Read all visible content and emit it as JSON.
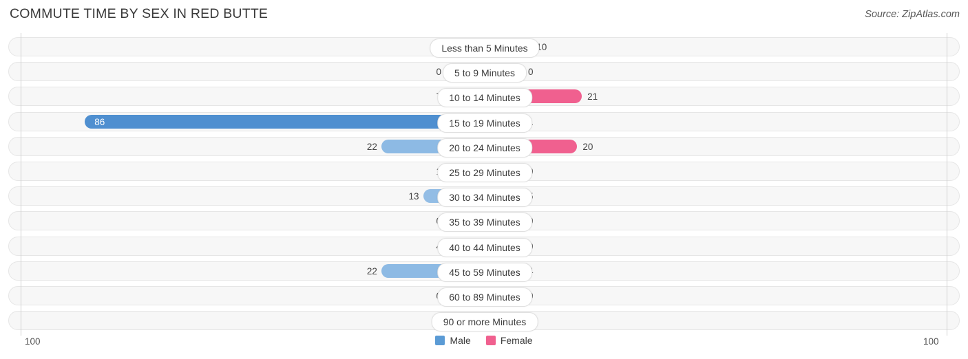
{
  "header": {
    "title": "COMMUTE TIME BY SEX IN RED BUTTE",
    "source": "Source: ZipAtlas.com"
  },
  "legend": {
    "items": [
      {
        "label": "Male",
        "color": "#5b9bd5"
      },
      {
        "label": "Female",
        "color": "#f0608f"
      }
    ]
  },
  "axis": {
    "left_tick": "100",
    "right_tick": "100",
    "max": 100
  },
  "chart_data": {
    "type": "bar",
    "subtype": "diverging-bidirectional",
    "title": "COMMUTE TIME BY SEX IN RED BUTTE",
    "xlabel": "",
    "ylabel": "",
    "xlim": [
      100,
      100
    ],
    "grid": false,
    "legend_position": "bottom-center",
    "categories": [
      "Less than 5 Minutes",
      "5 to 9 Minutes",
      "10 to 14 Minutes",
      "15 to 19 Minutes",
      "20 to 24 Minutes",
      "25 to 29 Minutes",
      "30 to 34 Minutes",
      "35 to 39 Minutes",
      "40 to 44 Minutes",
      "45 to 59 Minutes",
      "60 to 89 Minutes",
      "90 or more Minutes"
    ],
    "series": [
      {
        "name": "Male",
        "direction": "left",
        "color": "#5b9bd5",
        "values": [
          0,
          0,
          7,
          86,
          22,
          1,
          13,
          0,
          4,
          22,
          0,
          0
        ]
      },
      {
        "name": "Female",
        "direction": "right",
        "color": "#f0608f",
        "values": [
          10,
          0,
          21,
          1,
          20,
          0,
          5,
          0,
          0,
          4,
          0,
          0
        ]
      }
    ]
  },
  "rows": [
    {
      "label": "Less than 5 Minutes",
      "male": "0",
      "female": "10"
    },
    {
      "label": "5 to 9 Minutes",
      "male": "0",
      "female": "0"
    },
    {
      "label": "10 to 14 Minutes",
      "male": "7",
      "female": "21"
    },
    {
      "label": "15 to 19 Minutes",
      "male": "86",
      "female": "1"
    },
    {
      "label": "20 to 24 Minutes",
      "male": "22",
      "female": "20"
    },
    {
      "label": "25 to 29 Minutes",
      "male": "1",
      "female": "0"
    },
    {
      "label": "30 to 34 Minutes",
      "male": "13",
      "female": "5"
    },
    {
      "label": "35 to 39 Minutes",
      "male": "0",
      "female": "0"
    },
    {
      "label": "40 to 44 Minutes",
      "male": "4",
      "female": "0"
    },
    {
      "label": "45 to 59 Minutes",
      "male": "22",
      "female": "4"
    },
    {
      "label": "60 to 89 Minutes",
      "male": "0",
      "female": "0"
    },
    {
      "label": "90 or more Minutes",
      "male": "0",
      "female": "0"
    }
  ]
}
